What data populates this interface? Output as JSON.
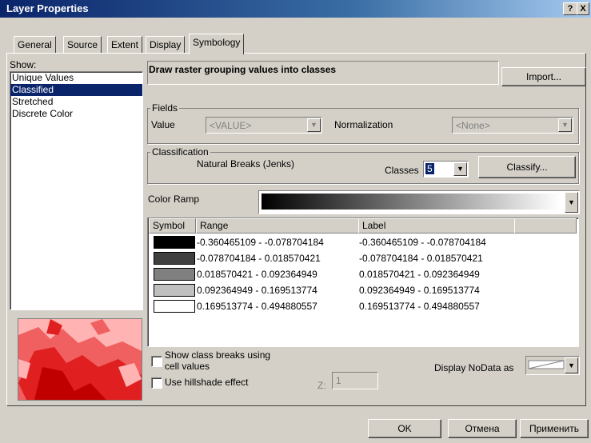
{
  "window": {
    "title": "Layer Properties",
    "help_btn": "?",
    "close_btn": "X"
  },
  "tabs": [
    "General",
    "Source",
    "Extent",
    "Display",
    "Symbology"
  ],
  "active_tab": "Symbology",
  "show": {
    "label": "Show:",
    "items": [
      "Unique Values",
      "Classified",
      "Stretched",
      "Discrete Color"
    ],
    "selected": "Classified"
  },
  "heading": "Draw raster grouping values into classes",
  "import_button": "Import...",
  "fields": {
    "group_label": "Fields",
    "value_label": "Value",
    "value_selected": "<VALUE>",
    "normalization_label": "Normalization",
    "normalization_selected": "<None>"
  },
  "classification": {
    "group_label": "Classification",
    "method": "Natural Breaks (Jenks)",
    "classes_label": "Classes",
    "classes_value": "5",
    "classify_button": "Classify..."
  },
  "color_ramp": {
    "label": "Color Ramp",
    "start_color": "#000000",
    "end_color": "#ffffff"
  },
  "table": {
    "headers": {
      "symbol": "Symbol",
      "range": "Range",
      "label": "Label"
    },
    "rows": [
      {
        "color": "#000000",
        "range": "-0.360465109 - -0.078704184",
        "label": "-0.360465109 - -0.078704184"
      },
      {
        "color": "#404040",
        "range": "-0.078704184 - 0.018570421",
        "label": "-0.078704184 - 0.018570421"
      },
      {
        "color": "#808080",
        "range": "0.018570421 - 0.092364949",
        "label": "0.018570421 - 0.092364949"
      },
      {
        "color": "#bfbfbf",
        "range": "0.092364949 - 0.169513774",
        "label": "0.092364949 - 0.169513774"
      },
      {
        "color": "#ffffff",
        "range": "0.169513774 - 0.494880557",
        "label": "0.169513774 - 0.494880557"
      }
    ]
  },
  "options": {
    "show_class_breaks": "Show class breaks using cell values",
    "use_hillshade": "Use hillshade effect",
    "z_label": "Z:",
    "z_value": "1",
    "nodata_label": "Display NoData as"
  },
  "footer": {
    "ok": "OK",
    "cancel": "Отмена",
    "apply": "Применить"
  }
}
